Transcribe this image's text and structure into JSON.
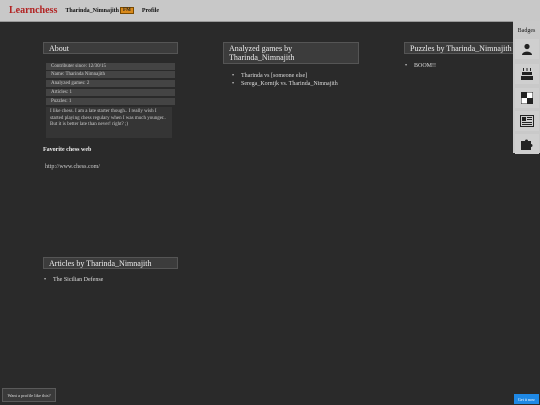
{
  "topbar": {
    "logo": "Learnchess",
    "user": "Tharinda_Nimnajith",
    "user_badge": "FM",
    "profile": "Profile"
  },
  "about": {
    "title": "About",
    "rows": [
      "Contributer since: 12/30/15",
      "Name: Tharinda Nimnajith",
      "Analyzed games: 2",
      "Articles: 1",
      "Puzzles: 1"
    ],
    "bio": "I like chess. I am a late starter though.. I really wish I started playing chess regulary when I was much younger.. But it is better late than never! right? ;)",
    "favorite_label": "Favorite chess web",
    "favorite_url": "http://www.chess.com/"
  },
  "analyzed": {
    "title_line1": "Analyzed games by",
    "title_line2": "Tharinda_Nimnajith",
    "items": [
      "Tharinda vs [someone else]",
      "Serega_Korntjk vs. Tharinda_Nimnajith"
    ]
  },
  "puzzles": {
    "title": "Puzzles by Tharinda_Nimnajith",
    "items": [
      "BOOM!!"
    ]
  },
  "articles": {
    "title": "Articles by Tharinda_Nimnajith",
    "items": [
      "The Sicilian Defense"
    ]
  },
  "sidebar": {
    "label": "Badges",
    "buttons": [
      "user-icon",
      "cake-icon",
      "chessboard-icon",
      "newspaper-icon",
      "puzzle-icon"
    ]
  },
  "footer": {
    "want_profile": "Want a profile like this?",
    "corner_button": "Get it now"
  },
  "colors": {
    "background": "#2a2a2a",
    "logo": "#b22222",
    "badge": "#d98a1c",
    "corner_button": "#1e88e5"
  }
}
